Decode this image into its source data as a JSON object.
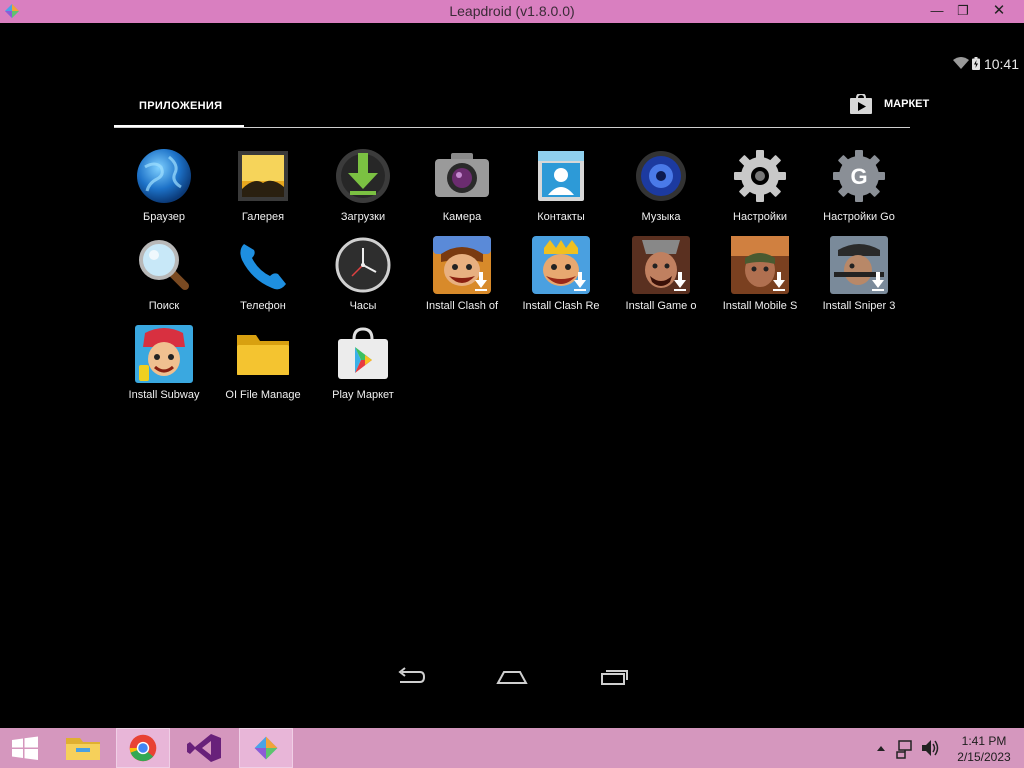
{
  "window": {
    "title": "Leapdroid (v1.8.0.0)",
    "minimize_glyph": "—",
    "maximize_glyph": "❐",
    "close_glyph": "✕"
  },
  "statusbar": {
    "time": "10:41"
  },
  "tabs": {
    "apps_label": "ПРИЛОЖЕНИЯ",
    "market_label": "МАРКЕТ"
  },
  "apps": [
    {
      "label": "Браузер",
      "icon": "browser-globe-icon"
    },
    {
      "label": "Галерея",
      "icon": "gallery-icon"
    },
    {
      "label": "Загрузки",
      "icon": "downloads-icon"
    },
    {
      "label": "Камера",
      "icon": "camera-icon"
    },
    {
      "label": "Контакты",
      "icon": "contacts-icon"
    },
    {
      "label": "Музыка",
      "icon": "music-icon"
    },
    {
      "label": "Настройки",
      "icon": "settings-gear-icon"
    },
    {
      "label": "Настройки Go",
      "icon": "google-settings-icon"
    },
    {
      "label": "Поиск",
      "icon": "search-magnifier-icon"
    },
    {
      "label": "Телефон",
      "icon": "phone-icon"
    },
    {
      "label": "Часы",
      "icon": "clock-icon"
    },
    {
      "label": "Install Clash of",
      "icon": "clash-of-clans-icon"
    },
    {
      "label": "Install Clash Re",
      "icon": "clash-royale-icon"
    },
    {
      "label": "Install Game o",
      "icon": "game-of-war-icon"
    },
    {
      "label": "Install Mobile S",
      "icon": "mobile-strike-icon"
    },
    {
      "label": "Install Sniper 3",
      "icon": "sniper-3d-icon"
    },
    {
      "label": "Install Subway",
      "icon": "subway-surfers-icon"
    },
    {
      "label": "OI File Manage",
      "icon": "folder-icon"
    },
    {
      "label": "Play Маркет",
      "icon": "play-store-icon"
    }
  ],
  "taskbar": {
    "time": "1:41 PM",
    "date": "2/15/2023",
    "items": [
      "start",
      "file-explorer",
      "chrome",
      "visual-studio",
      "leapdroid"
    ]
  },
  "colors": {
    "titlebar": "#d97fc0",
    "taskbar": "#d597be",
    "screen": "#000000"
  }
}
